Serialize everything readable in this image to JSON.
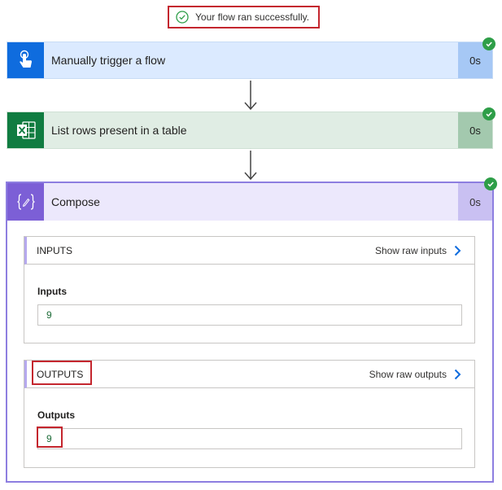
{
  "banner": {
    "text": "Your flow ran successfully."
  },
  "steps": [
    {
      "title": "Manually trigger a flow",
      "duration": "0s",
      "icon": "touch-hand-icon"
    },
    {
      "title": "List rows present in a table",
      "duration": "0s",
      "icon": "excel-icon"
    }
  ],
  "compose": {
    "title": "Compose",
    "duration": "0s",
    "icon": "expression-braces-icon",
    "inputs": {
      "header": "INPUTS",
      "raw_link": "Show raw inputs",
      "field_label": "Inputs",
      "value": "9"
    },
    "outputs": {
      "header": "OUTPUTS",
      "raw_link": "Show raw outputs",
      "field_label": "Outputs",
      "value": "9"
    }
  },
  "colors": {
    "trigger_accent": "#0f6cde",
    "excel_accent": "#107c41",
    "compose_accent": "#7c5fd6",
    "success": "#2e9e48",
    "highlight": "#c4262e"
  }
}
